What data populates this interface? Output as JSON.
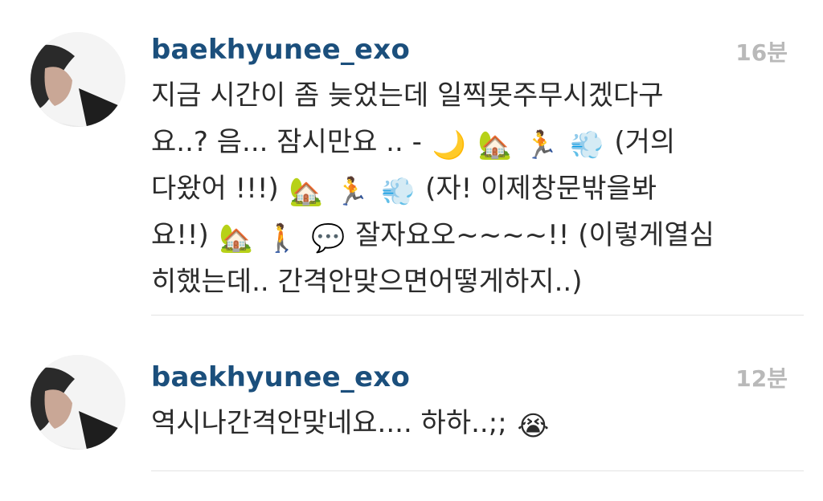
{
  "comments": [
    {
      "username": "baekhyunee_exo",
      "timestamp": "16분",
      "lines": [
        {
          "parts": [
            "지금 시간이 좀 늦었는데 일찍못주무시겠다구"
          ],
          "emojis": []
        },
        {
          "parts": [
            "요..? 음... 잠시만요 .. -",
            "",
            "",
            "",
            "(거의"
          ],
          "emojis": [
            "🌙",
            "🏡",
            "🏃",
            "💨"
          ]
        },
        {
          "parts": [
            "다왔어 !!!)",
            "",
            "",
            "(자! 이제창문밖을봐"
          ],
          "emojis": [
            "🏡",
            "🏃",
            "💨"
          ]
        },
        {
          "parts": [
            "요!!)",
            "",
            "",
            "잘자요오~~~~!! (이렇게열심"
          ],
          "emojis": [
            "🏡",
            "🚶",
            "💬"
          ]
        },
        {
          "parts": [
            "히했는데.. 간격안맞으면어떻게하지..)"
          ],
          "emojis": []
        }
      ]
    },
    {
      "username": "baekhyunee_exo",
      "timestamp": "12분",
      "lines": [
        {
          "parts": [
            "역시나간격안맞네요.... 하하..;;"
          ],
          "emojis": [
            "😭"
          ]
        }
      ]
    }
  ],
  "icons": {
    "moon": "crescent-moon-emoji",
    "house": "house-with-garden-emoji",
    "runner": "runner-emoji",
    "dash": "dash-emoji",
    "walker": "pedestrian-emoji",
    "speech": "speech-balloon-emoji",
    "crying": "loudly-crying-face-emoji"
  },
  "colors": {
    "username": "#1b4f7c",
    "timestamp": "#b9b9b9",
    "text": "#2b2b2b",
    "divider": "#e3e3e3"
  }
}
